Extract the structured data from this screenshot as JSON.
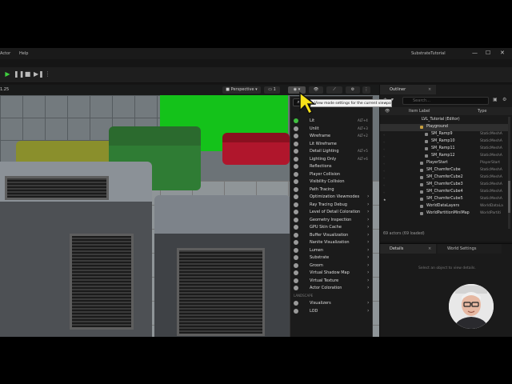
{
  "menubar": {
    "items": [
      "Actor",
      "Help"
    ],
    "title": "SubstrateTutorial"
  },
  "window_controls": {
    "minimize": "—",
    "maximize": "☐",
    "close": "✕"
  },
  "viewport_toolbar": {
    "zoom": "1.25",
    "perspective_label": "Perspective",
    "count_label": "1"
  },
  "view_mode_menu": {
    "tooltip": "View mode settings for the current viewport.",
    "items": [
      {
        "label": "Lit",
        "shortcut": "ALT+4"
      },
      {
        "label": "Unlit",
        "shortcut": "ALT+3"
      },
      {
        "label": "Wireframe",
        "shortcut": "ALT+2"
      },
      {
        "label": "Lit Wireframe",
        "shortcut": ""
      },
      {
        "label": "Detail Lighting",
        "shortcut": "ALT+5"
      },
      {
        "label": "Lighting Only",
        "shortcut": "ALT+6"
      },
      {
        "label": "Reflections",
        "shortcut": ""
      },
      {
        "label": "Player Collision",
        "shortcut": ""
      },
      {
        "label": "Visibility Collision",
        "shortcut": ""
      },
      {
        "label": "Path Tracing",
        "shortcut": ""
      },
      {
        "label": "Optimization Viewmodes",
        "shortcut": ""
      },
      {
        "label": "Ray Tracing Debug",
        "shortcut": ""
      },
      {
        "label": "Level of Detail Coloration",
        "shortcut": ""
      },
      {
        "label": "Geometry Inspection",
        "shortcut": ""
      },
      {
        "label": "GPU Skin Cache",
        "shortcut": ""
      },
      {
        "label": "Buffer Visualization",
        "shortcut": ""
      },
      {
        "label": "Nanite Visualization",
        "shortcut": ""
      },
      {
        "label": "Lumen",
        "shortcut": ""
      },
      {
        "label": "Substrate",
        "shortcut": ""
      },
      {
        "label": "Groom",
        "shortcut": ""
      },
      {
        "label": "Virtual Shadow Map",
        "shortcut": ""
      },
      {
        "label": "Virtual Texture",
        "shortcut": ""
      },
      {
        "label": "Actor Coloration",
        "shortcut": ""
      }
    ],
    "section_label": "LANDSCAPE",
    "extra_items": [
      {
        "label": "Visualizers"
      },
      {
        "label": "LOD"
      }
    ]
  },
  "outliner": {
    "tab_label": "Outliner",
    "search_placeholder": "Search...",
    "col_item_label": "Item Label",
    "col_type": "Type",
    "rows": [
      {
        "label": "LVL_Tutorial (Editor)",
        "type": "",
        "indent": 1
      },
      {
        "label": "Playground",
        "type": "",
        "indent": 2
      },
      {
        "label": "SM_Ramp9",
        "type": "StaticMeshA",
        "indent": 3
      },
      {
        "label": "SM_Ramp10",
        "type": "StaticMeshA",
        "indent": 3
      },
      {
        "label": "SM_Ramp11",
        "type": "StaticMeshA",
        "indent": 3
      },
      {
        "label": "SM_Ramp12",
        "type": "StaticMeshA",
        "indent": 3
      },
      {
        "label": "PlayerStart",
        "type": "PlayerStart",
        "indent": 2
      },
      {
        "label": "SM_ChamferCube",
        "type": "StaticMeshA",
        "indent": 2
      },
      {
        "label": "SM_ChamferCube2",
        "type": "StaticMeshA",
        "indent": 2
      },
      {
        "label": "SM_ChamferCube3",
        "type": "StaticMeshA",
        "indent": 2
      },
      {
        "label": "SM_ChamferCube4",
        "type": "StaticMeshA",
        "indent": 2
      },
      {
        "label": "SM_ChamferCube5",
        "type": "StaticMeshA",
        "indent": 2
      },
      {
        "label": "WorldDataLayers",
        "type": "WorldDataLa",
        "indent": 2
      },
      {
        "label": "WorldPartitionMiniMap",
        "type": "WorldPartiti",
        "indent": 2
      }
    ],
    "footer": "69 actors (69 loaded)"
  },
  "details": {
    "tab_label": "Details",
    "world_settings_label": "World Settings",
    "empty_text": "Select an object to view details."
  }
}
